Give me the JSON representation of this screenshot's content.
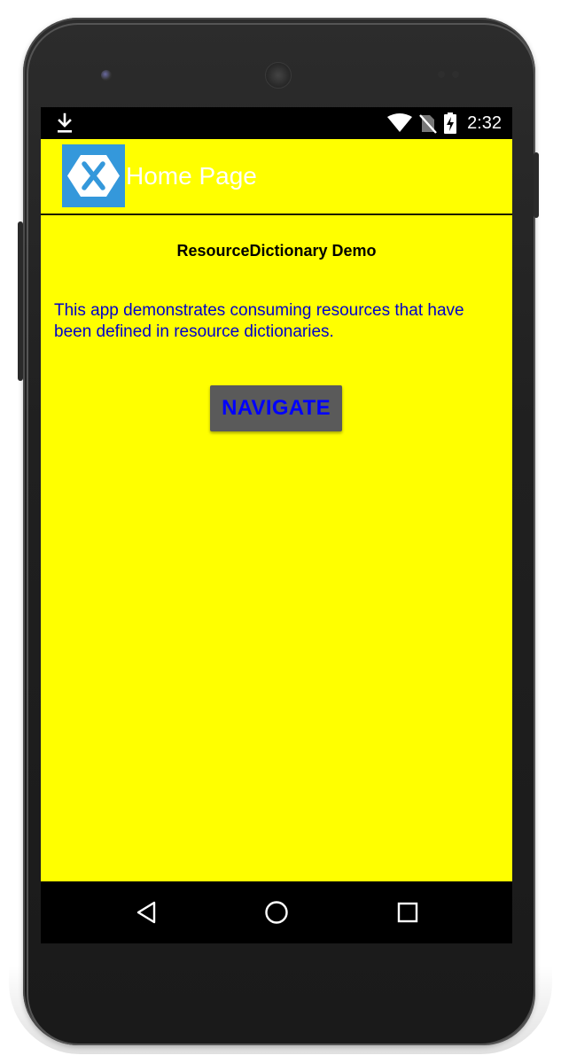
{
  "status_bar": {
    "time": "2:32",
    "icons": [
      "download-icon",
      "wifi-icon",
      "no-sim-icon",
      "battery-charging-icon"
    ]
  },
  "app_bar": {
    "title": "Home Page",
    "logo_icon": "xamarin-logo-icon",
    "logo_color": "#3498db"
  },
  "main": {
    "heading": "ResourceDictionary Demo",
    "description": "This app demonstrates consuming resources that have been defined in resource dictionaries.",
    "navigate_button_label": "NAVIGATE"
  },
  "nav_bar": {
    "buttons": [
      "back-icon",
      "home-icon",
      "recents-icon"
    ]
  },
  "colors": {
    "page_background": "#ffff00",
    "text_color": "#0000cc",
    "button_background": "#5a5a5a",
    "button_text": "#0000ff",
    "title_color": "#ffffff"
  }
}
